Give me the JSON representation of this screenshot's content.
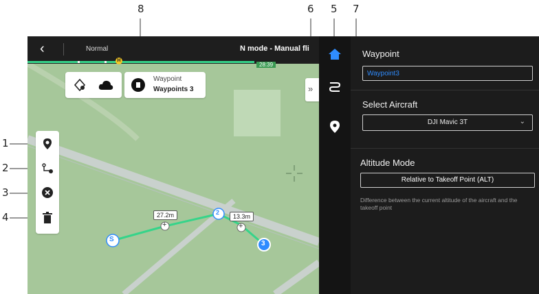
{
  "callouts": [
    "1",
    "2",
    "3",
    "4",
    "5",
    "6",
    "7",
    "8"
  ],
  "topbar": {
    "back_icon": "chevron-left-icon",
    "mode": "Normal",
    "flight_mode": "N mode - Manual fli",
    "timer": "28:39",
    "marker_letter": "H"
  },
  "map_tools": {
    "icons": [
      "tilted-layer-icon",
      "cloud-icon"
    ],
    "route_icon": "route-file-icon",
    "route_label": "Waypoint",
    "route_name": "Waypoints 3",
    "expand_icon": "double-chevron-right-icon"
  },
  "left_toolbar": {
    "items": [
      "add-waypoint-icon",
      "reverse-route-icon",
      "clear-waypoint-icon",
      "delete-icon"
    ]
  },
  "route": {
    "start_label": "S",
    "waypoint2_label": "2",
    "waypoint3_label": "3",
    "segment1_distance": "27.2m",
    "segment2_distance": "13.3m",
    "add_icon": "+"
  },
  "rail": {
    "icons": [
      "home-icon",
      "route-list-icon",
      "location-pin-icon"
    ]
  },
  "sidebar": {
    "waypoint_title": "Waypoint",
    "waypoint_name": "Waypoint3",
    "aircraft_title": "Select Aircraft",
    "aircraft_value": "DJI Mavic 3T",
    "altitude_title": "Altitude Mode",
    "altitude_value": "Relative to Takeoff Point (ALT)",
    "altitude_desc": "Difference between the current altitude of the aircraft and the takeoff point"
  },
  "colors": {
    "map_green": "#a6c79a",
    "accent_blue": "#2f8cff",
    "route_green": "#35d48a",
    "status_yellow": "#f3c623",
    "road": "#c9d1cd"
  }
}
